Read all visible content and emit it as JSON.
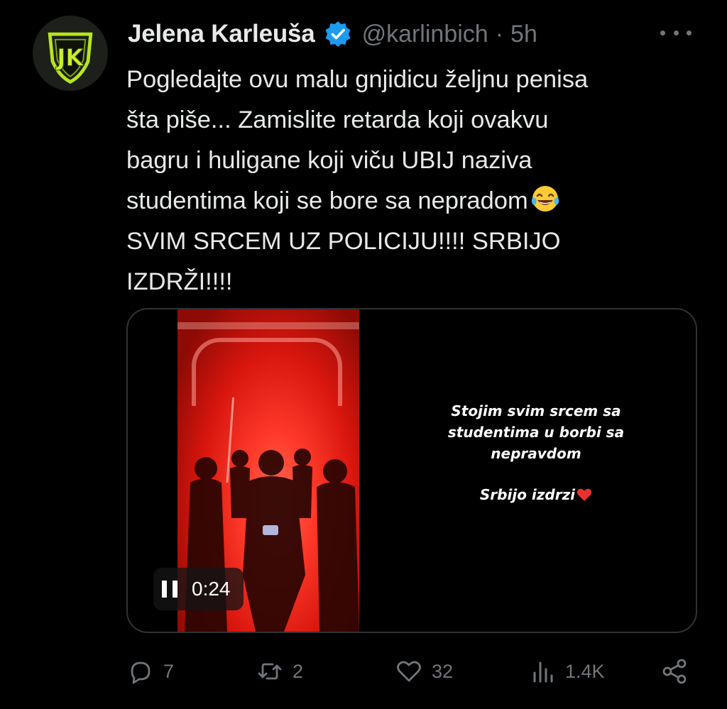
{
  "author": {
    "display_name": "Jelena Karleuša",
    "handle": "@karlinbich",
    "separator": "·",
    "time": "5h",
    "verified": true,
    "avatar_icon": "jk-shield-logo"
  },
  "tweet": {
    "lines": [
      "Pogledajte ovu malu gnjidicu željnu penisa",
      "šta piše... Zamislite retarda koji ovakvu",
      "bagru i huligane koji viču UBIJ naziva",
      "studentima koji se bore sa nepradom",
      "SVIM SRCEM UZ POLICIJU!!!! SRBIJO",
      "IZDRŽI!!!!"
    ],
    "emoji": "face-with-tears-of-joy"
  },
  "media": {
    "story_line1": "Stojim svim srcem sa studentima u borbi sa nepravdom",
    "story_line2": "Srbijo izdrzi",
    "story_emoji": "red-heart",
    "duration": "0:24",
    "player_state": "playing"
  },
  "actions": {
    "replies": "7",
    "retweets": "2",
    "likes": "32",
    "views": "1.4K"
  },
  "colors": {
    "background": "#000000",
    "text": "#e7e9ea",
    "muted": "#71767b",
    "verified": "#1d9bf0",
    "border": "#2f3336",
    "logo_green": "#b6e61c"
  }
}
